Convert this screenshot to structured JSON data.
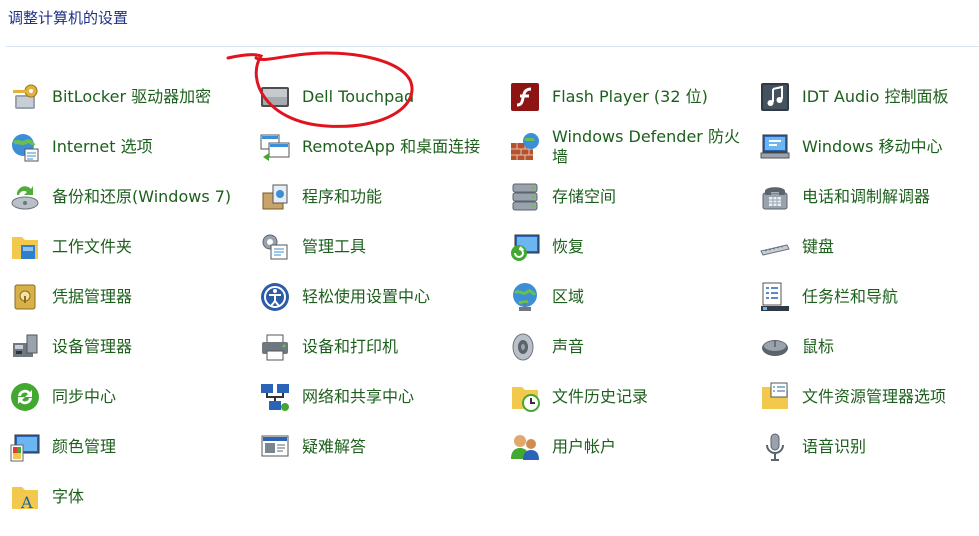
{
  "header": {
    "title": "调整计算机的设置"
  },
  "items": [
    {
      "label": "BitLocker 驱动器加密",
      "icon": "bitlocker-key-icon"
    },
    {
      "label": "Dell Touchpad",
      "icon": "touchpad-icon"
    },
    {
      "label": "Flash Player (32 位)",
      "icon": "flash-player-icon"
    },
    {
      "label": "IDT Audio 控制面板",
      "icon": "music-note-icon"
    },
    {
      "label": "Internet 选项",
      "icon": "internet-globe-icon"
    },
    {
      "label": "RemoteApp 和桌面连接",
      "icon": "remote-desktop-icon"
    },
    {
      "label": "Windows Defender 防火墙",
      "icon": "firewall-brick-icon"
    },
    {
      "label": "Windows 移动中心",
      "icon": "mobility-center-icon"
    },
    {
      "label": "备份和还原(Windows 7)",
      "icon": "backup-restore-icon"
    },
    {
      "label": "程序和功能",
      "icon": "programs-box-icon"
    },
    {
      "label": "存储空间",
      "icon": "storage-drives-icon"
    },
    {
      "label": "电话和调制解调器",
      "icon": "phone-modem-icon"
    },
    {
      "label": "工作文件夹",
      "icon": "work-folder-icon"
    },
    {
      "label": "管理工具",
      "icon": "admin-tools-icon"
    },
    {
      "label": "恢复",
      "icon": "recovery-icon"
    },
    {
      "label": "键盘",
      "icon": "keyboard-icon"
    },
    {
      "label": "凭据管理器",
      "icon": "credential-vault-icon"
    },
    {
      "label": "轻松使用设置中心",
      "icon": "ease-of-access-icon"
    },
    {
      "label": "区域",
      "icon": "region-globe-icon"
    },
    {
      "label": "任务栏和导航",
      "icon": "taskbar-icon"
    },
    {
      "label": "设备管理器",
      "icon": "device-manager-icon"
    },
    {
      "label": "设备和打印机",
      "icon": "printer-icon"
    },
    {
      "label": "声音",
      "icon": "speaker-icon"
    },
    {
      "label": "鼠标",
      "icon": "mouse-icon"
    },
    {
      "label": "同步中心",
      "icon": "sync-icon"
    },
    {
      "label": "网络和共享中心",
      "icon": "network-icon"
    },
    {
      "label": "文件历史记录",
      "icon": "file-history-icon"
    },
    {
      "label": "文件资源管理器选项",
      "icon": "folder-options-icon"
    },
    {
      "label": "颜色管理",
      "icon": "color-management-icon"
    },
    {
      "label": "疑难解答",
      "icon": "troubleshooting-icon"
    },
    {
      "label": "用户帐户",
      "icon": "user-accounts-icon"
    },
    {
      "label": "语音识别",
      "icon": "microphone-icon"
    },
    {
      "label": "字体",
      "icon": "fonts-icon"
    }
  ],
  "annotation": {
    "color": "#e0141e",
    "target": "Dell Touchpad"
  },
  "colors": {
    "label": "#1c5f1c",
    "header": "#1e3287",
    "divider": "#d7e4f0"
  }
}
